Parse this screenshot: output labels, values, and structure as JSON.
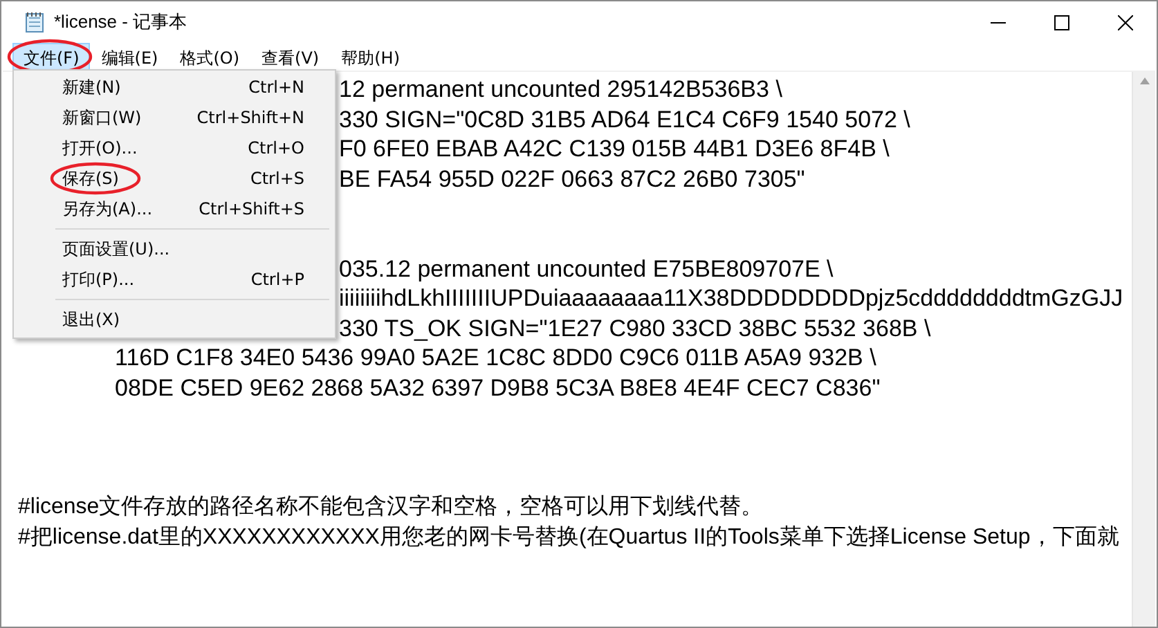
{
  "window": {
    "title": "*license - 记事本"
  },
  "menu_bar": [
    {
      "label": "文件(F)",
      "selected": true,
      "annotated": true
    },
    {
      "label": "编辑(E)",
      "selected": false,
      "annotated": false
    },
    {
      "label": "格式(O)",
      "selected": false,
      "annotated": false
    },
    {
      "label": "查看(V)",
      "selected": false,
      "annotated": false
    },
    {
      "label": "帮助(H)",
      "selected": false,
      "annotated": false
    }
  ],
  "file_menu": [
    {
      "kind": "item",
      "label": "新建(N)",
      "shortcut": "Ctrl+N",
      "annotated": false
    },
    {
      "kind": "item",
      "label": "新窗口(W)",
      "shortcut": "Ctrl+Shift+N",
      "annotated": false
    },
    {
      "kind": "item",
      "label": "打开(O)...",
      "shortcut": "Ctrl+O",
      "annotated": false
    },
    {
      "kind": "item",
      "label": "保存(S)",
      "shortcut": "Ctrl+S",
      "annotated": true
    },
    {
      "kind": "item",
      "label": "另存为(A)...",
      "shortcut": "Ctrl+Shift+S",
      "annotated": false
    },
    {
      "kind": "separator"
    },
    {
      "kind": "item",
      "label": "页面设置(U)...",
      "annotated": false
    },
    {
      "kind": "item",
      "label": "打印(P)...",
      "shortcut": "Ctrl+P",
      "annotated": false
    },
    {
      "kind": "separator"
    },
    {
      "kind": "item",
      "label": "退出(X)",
      "annotated": false
    }
  ],
  "editor_lines": [
    {
      "kind": "partial",
      "text": "12 permanent uncounted 295142B536B3 \\"
    },
    {
      "kind": "partial",
      "text": "330 SIGN=\"0C8D 31B5 AD64 E1C4 C6F9 1540 5072 \\"
    },
    {
      "kind": "partial",
      "text": "F0 6FE0 EBAB A42C C139 015B 44B1 D3E6 8F4B \\"
    },
    {
      "kind": "partial",
      "text": "BE FA54 955D 022F 0663 87C2 26B0 7305\""
    },
    {
      "kind": "blank"
    },
    {
      "kind": "blank"
    },
    {
      "kind": "partial",
      "text": "035.12 permanent uncounted E75BE809707E \\"
    },
    {
      "kind": "partial",
      "text": "iiiiiiiihdLkhIIIIIIIUPDuiaaaaaaaa11X38DDDDDDDDpjz5cddddddddtmGzGJJ"
    },
    {
      "kind": "partial",
      "text": "330 TS_OK SIGN=\"1E27 C980 33CD 38BC 5532 368B \\"
    },
    {
      "kind": "indented",
      "text": "116D C1F8 34E0 5436 99A0 5A2E 1C8C 8DD0 C9C6 011B A5A9 932B \\"
    },
    {
      "kind": "indented",
      "text": "08DE C5ED 9E62 2868 5A32 6397 D9B8 5C3A B8E8 4E4F CEC7 C836\""
    },
    {
      "kind": "blank"
    },
    {
      "kind": "blank"
    },
    {
      "kind": "blank"
    },
    {
      "kind": "plain",
      "text": "#license文件存放的路径名称不能包含汉字和空格，空格可以用下划线代替。"
    },
    {
      "kind": "plain",
      "text": "#把license.dat里的XXXXXXXXXXXX用您老的网卡号替换(在Quartus II的Tools菜单下选择License Setup，下面就"
    }
  ]
}
